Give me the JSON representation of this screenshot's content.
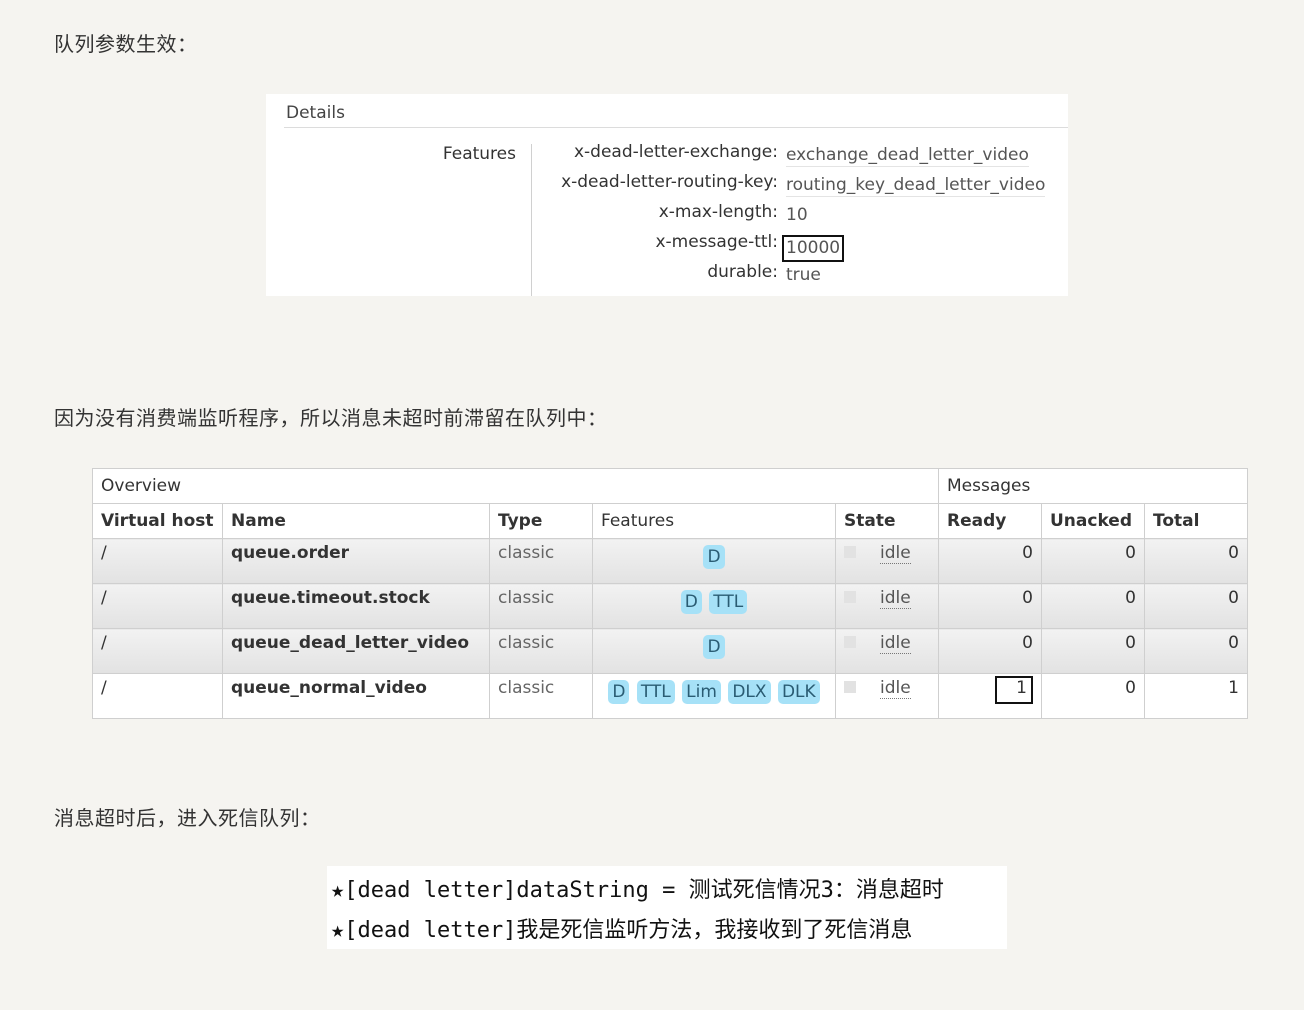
{
  "paragraphs": {
    "p1": "队列参数生效：",
    "p2": "因为没有消费端监听程序，所以消息未超时前滞留在队列中：",
    "p3": "消息超时后，进入死信队列："
  },
  "details": {
    "title": "Details",
    "section_label": "Features",
    "features": [
      {
        "key": "x-dead-letter-exchange:",
        "value": "exchange_dead_letter_video"
      },
      {
        "key": "x-dead-letter-routing-key:",
        "value": "routing_key_dead_letter_video"
      },
      {
        "key": "x-max-length:",
        "value": "10"
      },
      {
        "key": "x-message-ttl:",
        "value": "10000"
      },
      {
        "key": "durable:",
        "value": "true"
      }
    ]
  },
  "queues_table": {
    "group_overview": "Overview",
    "group_messages": "Messages",
    "columns": [
      "Virtual host",
      "Name",
      "Type",
      "Features",
      "State",
      "Ready",
      "Unacked",
      "Total"
    ],
    "rows": [
      {
        "vhost": "/",
        "name": "queue.order",
        "type": "classic",
        "features": [
          "D"
        ],
        "state": "idle",
        "ready": "0",
        "unacked": "0",
        "total": "0"
      },
      {
        "vhost": "/",
        "name": "queue.timeout.stock",
        "type": "classic",
        "features": [
          "D",
          "TTL"
        ],
        "state": "idle",
        "ready": "0",
        "unacked": "0",
        "total": "0"
      },
      {
        "vhost": "/",
        "name": "queue_dead_letter_video",
        "type": "classic",
        "features": [
          "D"
        ],
        "state": "idle",
        "ready": "0",
        "unacked": "0",
        "total": "0"
      },
      {
        "vhost": "/",
        "name": "queue_normal_video",
        "type": "classic",
        "features": [
          "D",
          "TTL",
          "Lim",
          "DLX",
          "DLK"
        ],
        "state": "idle",
        "ready": "1",
        "unacked": "0",
        "total": "1"
      }
    ]
  },
  "console": {
    "line1": "★[dead letter]dataString = 测试死信情况3：消息超时",
    "line2": "★[dead letter]我是死信监听方法，我接收到了死信消息"
  },
  "colors": {
    "page_background": "#f5f4f0",
    "feature_tag": "#a6e1f7",
    "highlight_border": "#111111"
  }
}
